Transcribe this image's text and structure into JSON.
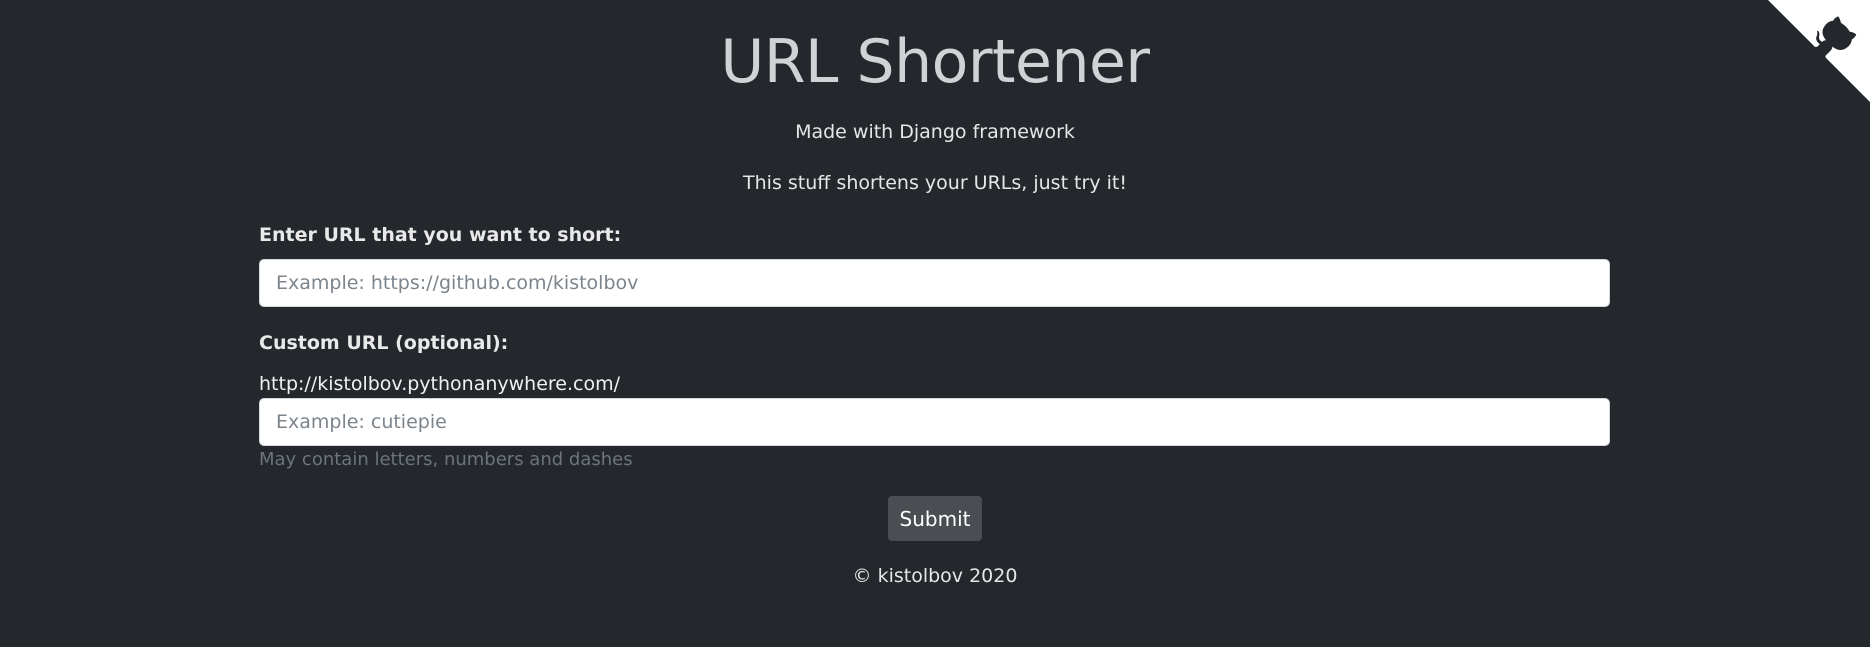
{
  "header": {
    "title": "URL Shortener",
    "made_with": "Made with Django framework",
    "tagline": "This stuff shortens your URLs, just try it!"
  },
  "form": {
    "url_label": "Enter URL that you want to short:",
    "url_placeholder": "Example: https://github.com/kistolbov",
    "url_value": "",
    "custom_label": "Custom URL (optional):",
    "custom_prefix": "http://kistolbov.pythonanywhere.com/",
    "custom_placeholder": "Example: cutiepie",
    "custom_value": "",
    "custom_help": "May contain letters, numbers and dashes",
    "submit_label": "Submit"
  },
  "footer": {
    "text": "© kistolbov 2020"
  },
  "icons": {
    "github_corner": "github-octocat-icon"
  },
  "colors": {
    "background": "#24282d",
    "button": "#4a4e53",
    "corner_fill": "#ffffff",
    "corner_octocat": "#24282d"
  }
}
